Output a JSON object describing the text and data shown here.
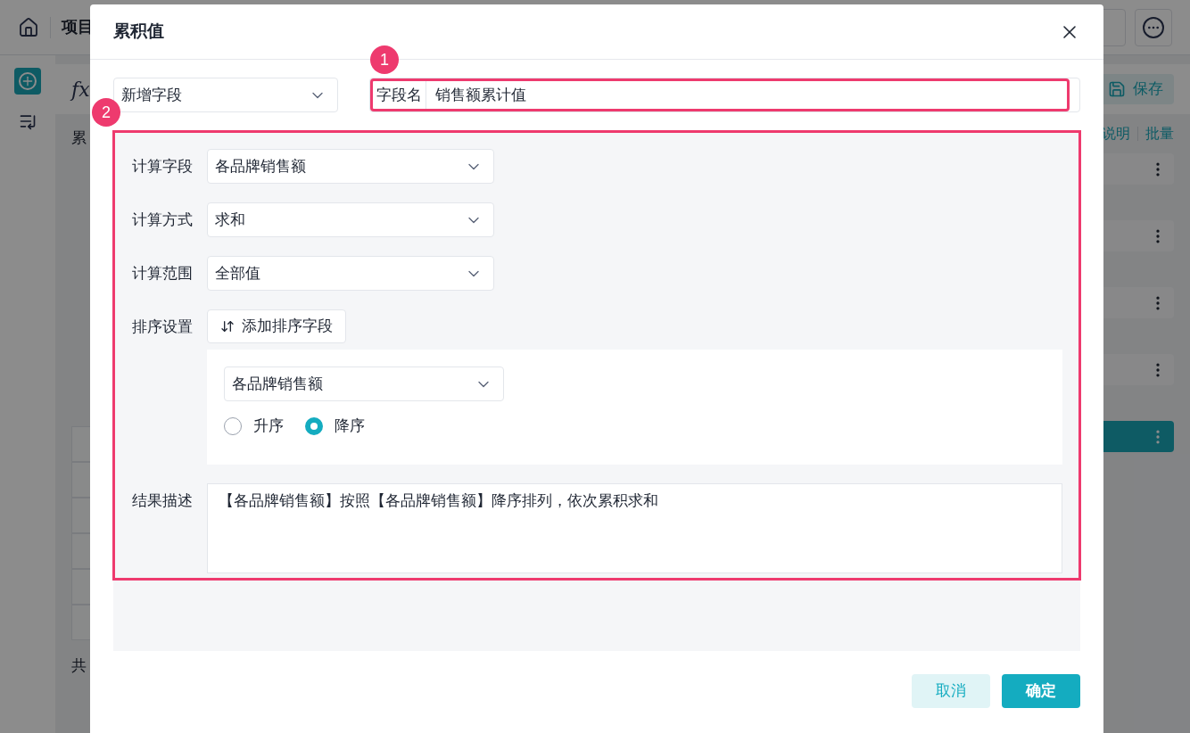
{
  "background": {
    "project_title": "项目",
    "fx": "fx",
    "save_button": "保存",
    "section_label": "累",
    "links": [
      "说明",
      "批量"
    ],
    "items": [
      {
        "selected": false
      },
      {
        "selected": false
      },
      {
        "selected": false
      },
      {
        "selected": false
      },
      {
        "selected": true
      }
    ],
    "footer_text": "共"
  },
  "dialog": {
    "title": "累积值",
    "field_type": "新增字段",
    "field_name_label": "字段名",
    "field_name": "销售额累计值",
    "form": [
      {
        "kind": "select",
        "label": "计算字段",
        "value": "各品牌销售额"
      },
      {
        "kind": "select",
        "label": "计算方式",
        "value": "求和"
      },
      {
        "kind": "select",
        "label": "计算范围",
        "value": "全部值"
      },
      {
        "kind": "sort",
        "label": "排序设置",
        "button": "添加排序字段",
        "sort_field": "各品牌销售额",
        "orders": [
          {
            "label": "升序",
            "selected": false
          },
          {
            "label": "降序",
            "selected": true
          }
        ]
      },
      {
        "kind": "textarea",
        "label": "结果描述",
        "value": "【各品牌销售额】按照【各品牌销售额】降序排列，依次累积求和"
      }
    ],
    "buttons": [
      {
        "label": "取消",
        "kind": "secondary"
      },
      {
        "label": "确定",
        "kind": "primary"
      }
    ]
  },
  "annotations": [
    {
      "label": "1"
    },
    {
      "label": "2"
    }
  ]
}
